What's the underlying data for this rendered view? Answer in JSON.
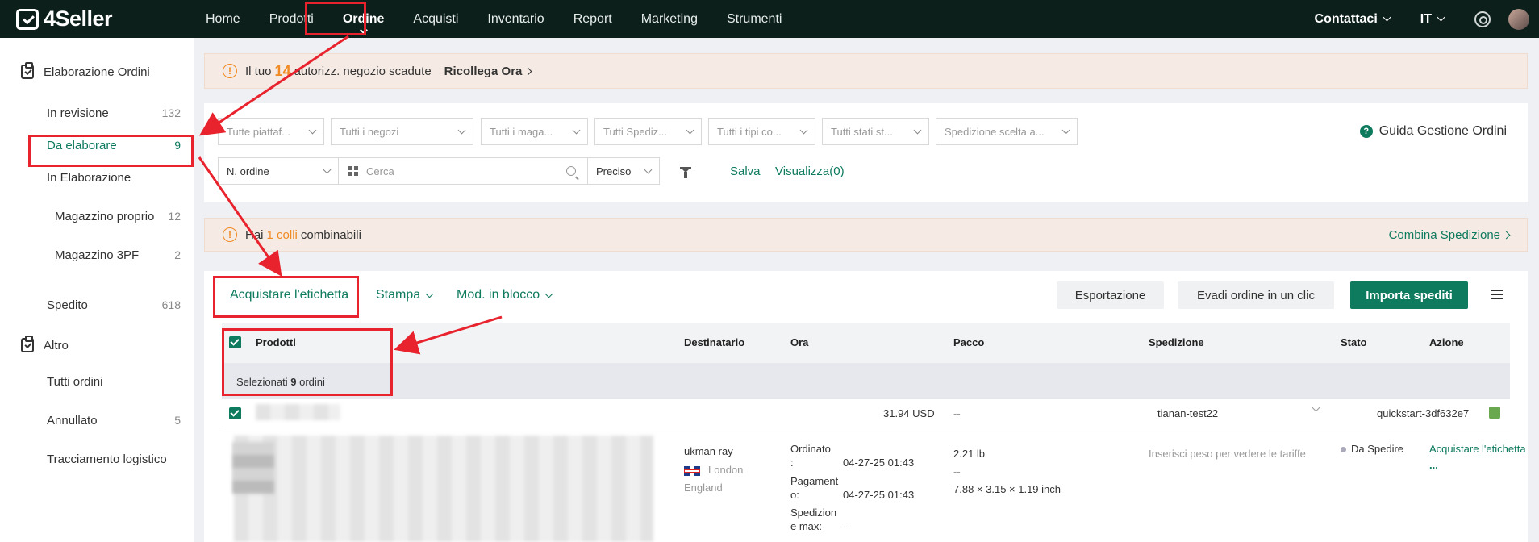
{
  "topbar": {
    "brand": "4Seller",
    "nav": [
      "Home",
      "Prodotti",
      "Ordine",
      "Acquisti",
      "Inventario",
      "Report",
      "Marketing",
      "Strumenti"
    ],
    "active_nav": "Ordine",
    "contact": "Contattaci",
    "language": "IT"
  },
  "sidebar": {
    "group1": "Elaborazione Ordini",
    "group2": "Altro",
    "items": [
      {
        "label": "In revisione",
        "count": "132"
      },
      {
        "label": "Da elaborare",
        "count": "9"
      },
      {
        "label": "In Elaborazione",
        "count": ""
      },
      {
        "label": "Magazzino proprio",
        "count": "12"
      },
      {
        "label": "Magazzino 3PF",
        "count": "2"
      },
      {
        "label": "Spedito",
        "count": "618"
      },
      {
        "label": "Tutti ordini",
        "count": ""
      },
      {
        "label": "Annullato",
        "count": "5"
      },
      {
        "label": "Tracciamento logistico",
        "count": ""
      }
    ]
  },
  "banner1": {
    "prefix": "Il tuo",
    "number": "14",
    "suffix": "autorizz. negozio scadute",
    "link": "Ricollega Ora"
  },
  "filters": {
    "selects": [
      "Tutte piattaf...",
      "Tutti i negozi",
      "Tutti i maga...",
      "Tutti Spediz...",
      "Tutti i tipi co...",
      "Tutti stati st...",
      "Spedizione scelta a..."
    ],
    "guide": "Guida Gestione Ordini",
    "search_type": "N. ordine",
    "search_placeholder": "Cerca",
    "match": "Preciso",
    "save": "Salva",
    "view": "Visualizza(0)"
  },
  "banner2": {
    "prefix": "Hai",
    "link": "1 colli",
    "suffix": "combinabili",
    "action": "Combina Spedizione"
  },
  "actions": {
    "buy_label": "Acquistare l'etichetta",
    "print": "Stampa",
    "bulk": "Mod. in blocco",
    "export": "Esportazione",
    "one_click": "Evadi ordine in un clic",
    "import": "Importa spediti"
  },
  "table": {
    "headers": [
      "Prodotti",
      "Destinatario",
      "Ora",
      "Pacco",
      "Spedizione",
      "Stato",
      "Azione"
    ],
    "selected_prefix": "Selezionati",
    "selected_count": "9",
    "selected_suffix": "ordini",
    "order": {
      "amount": "31.94 USD",
      "package_dash": "--",
      "shipping_account": "tianan-test22",
      "shop": "quickstart-3df632e7",
      "recipient_name": "ukman ray",
      "recipient_city": "London",
      "recipient_region": "England",
      "ordered_label_1": "Ordinato",
      "ordered_label_2": ":",
      "ordered_value": "04-27-25 01:43",
      "paid_label_1": "Pagament",
      "paid_label_2": "o:",
      "paid_value": "04-27-25 01:43",
      "ship_label_1": "Spedizion",
      "ship_label_2": "e max:",
      "ship_value": "--",
      "weight": "2.21 lb",
      "weight_dash": "--",
      "dimensions": "7.88 × 3.15 × 1.19 inch",
      "rate_hint": "Inserisci peso per vedere le tariffe",
      "status": "Da Spedire",
      "action": "Acquistare l'etichetta",
      "more": "..."
    }
  }
}
